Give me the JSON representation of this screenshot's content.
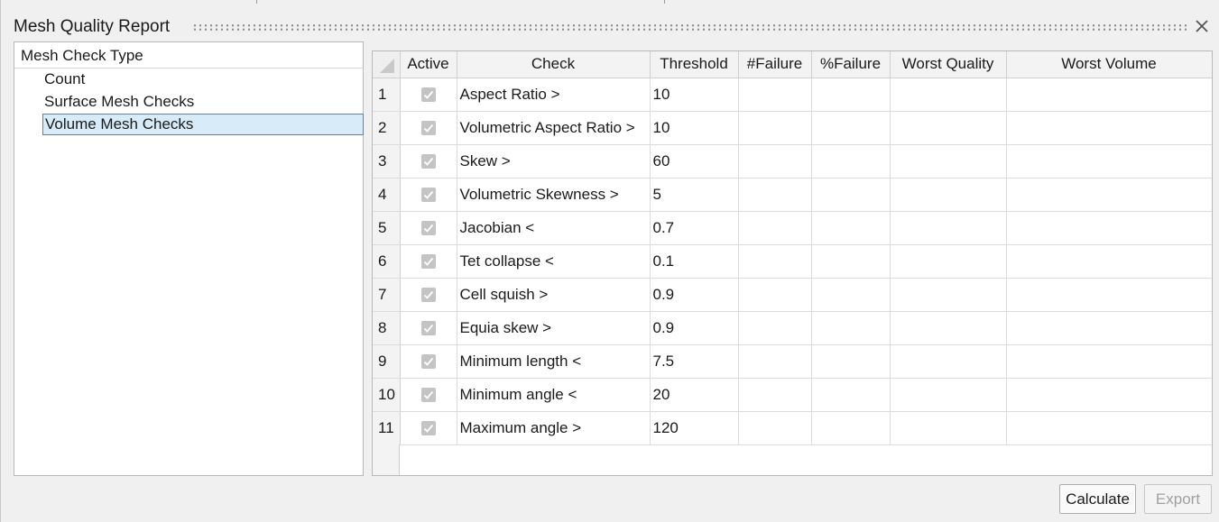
{
  "window": {
    "title": "Mesh Quality Report"
  },
  "left_panel": {
    "header": "Mesh Check Type",
    "items": [
      {
        "label": "Count",
        "selected": false
      },
      {
        "label": "Surface Mesh Checks",
        "selected": false
      },
      {
        "label": "Volume Mesh Checks",
        "selected": true
      }
    ]
  },
  "table": {
    "columns": [
      "Active",
      "Check",
      "Threshold",
      "#Failure",
      "%Failure",
      "Worst Quality",
      "Worst Volume"
    ],
    "rows": [
      {
        "num": "1",
        "active": true,
        "check": "Aspect Ratio >",
        "threshold": "10",
        "failure": "",
        "pct_failure": "",
        "worst_quality": "",
        "worst_volume": ""
      },
      {
        "num": "2",
        "active": true,
        "check": "Volumetric Aspect Ratio >",
        "threshold": "10",
        "failure": "",
        "pct_failure": "",
        "worst_quality": "",
        "worst_volume": ""
      },
      {
        "num": "3",
        "active": true,
        "check": "Skew >",
        "threshold": "60",
        "failure": "",
        "pct_failure": "",
        "worst_quality": "",
        "worst_volume": ""
      },
      {
        "num": "4",
        "active": true,
        "check": "Volumetric Skewness >",
        "threshold": "5",
        "failure": "",
        "pct_failure": "",
        "worst_quality": "",
        "worst_volume": ""
      },
      {
        "num": "5",
        "active": true,
        "check": "Jacobian <",
        "threshold": "0.7",
        "failure": "",
        "pct_failure": "",
        "worst_quality": "",
        "worst_volume": ""
      },
      {
        "num": "6",
        "active": true,
        "check": "Tet collapse <",
        "threshold": "0.1",
        "failure": "",
        "pct_failure": "",
        "worst_quality": "",
        "worst_volume": ""
      },
      {
        "num": "7",
        "active": true,
        "check": "Cell squish >",
        "threshold": "0.9",
        "failure": "",
        "pct_failure": "",
        "worst_quality": "",
        "worst_volume": ""
      },
      {
        "num": "8",
        "active": true,
        "check": "Equia skew >",
        "threshold": "0.9",
        "failure": "",
        "pct_failure": "",
        "worst_quality": "",
        "worst_volume": ""
      },
      {
        "num": "9",
        "active": true,
        "check": "Minimum length <",
        "threshold": "7.5",
        "failure": "",
        "pct_failure": "",
        "worst_quality": "",
        "worst_volume": ""
      },
      {
        "num": "10",
        "active": true,
        "check": "Minimum angle <",
        "threshold": "20",
        "failure": "",
        "pct_failure": "",
        "worst_quality": "",
        "worst_volume": ""
      },
      {
        "num": "11",
        "active": true,
        "check": "Maximum angle >",
        "threshold": "120",
        "failure": "",
        "pct_failure": "",
        "worst_quality": "",
        "worst_volume": ""
      }
    ]
  },
  "buttons": {
    "calculate": "Calculate",
    "export": "Export",
    "export_enabled": false
  },
  "icons": {
    "close": "close-icon",
    "checkbox": "check-icon",
    "corner": "select-all-triangle-icon"
  },
  "colors": {
    "selection_bg": "#d7ecf8",
    "selection_border": "#6a7f93",
    "checkbox_disabled": "#c4c4c4"
  }
}
